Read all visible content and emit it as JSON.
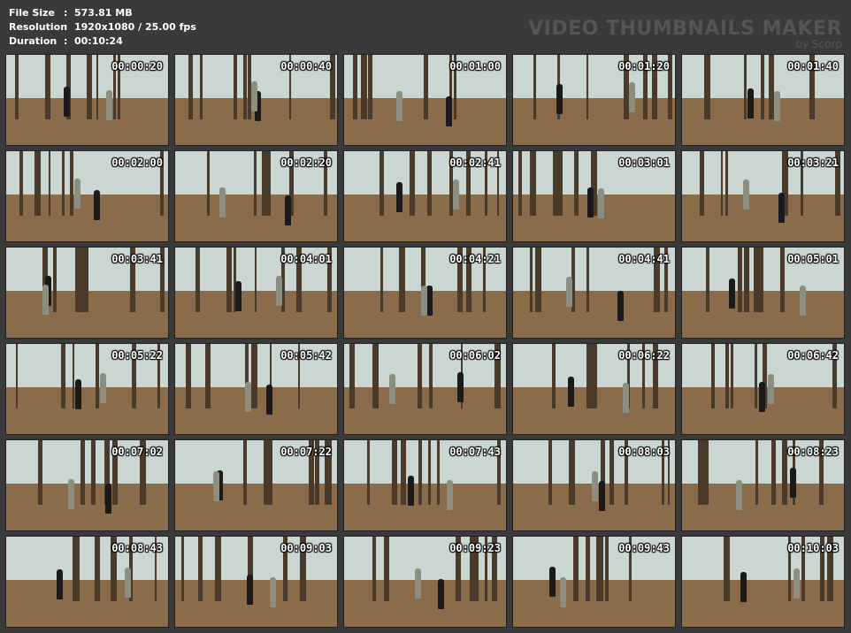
{
  "info": {
    "file_size_label": "File Size",
    "file_size_value": "573.81 MB",
    "resolution_label": "Resolution",
    "resolution_value": "1920x1080 / 25.00 fps",
    "duration_label": "Duration",
    "duration_value": "00:10:24",
    "separator": ":"
  },
  "watermark": {
    "title": "VIDEO THUMBNAILS MAKER",
    "subtitle": "by Scorp"
  },
  "colors": {
    "background": "#3a3a3a",
    "sky": "#c9d6d2",
    "ground": "#8a6c4a",
    "trunk": "#4a3a2a",
    "figure_dark": "#1a1a1a",
    "figure_camo": "#8c8f80"
  },
  "thumbnails": [
    {
      "time": "00:00:20"
    },
    {
      "time": "00:00:40"
    },
    {
      "time": "00:01:00"
    },
    {
      "time": "00:01:20"
    },
    {
      "time": "00:01:40"
    },
    {
      "time": "00:02:00"
    },
    {
      "time": "00:02:20"
    },
    {
      "time": "00:02:41"
    },
    {
      "time": "00:03:01"
    },
    {
      "time": "00:03:21"
    },
    {
      "time": "00:03:41"
    },
    {
      "time": "00:04:01"
    },
    {
      "time": "00:04:21"
    },
    {
      "time": "00:04:41"
    },
    {
      "time": "00:05:01"
    },
    {
      "time": "00:05:22"
    },
    {
      "time": "00:05:42"
    },
    {
      "time": "00:06:02"
    },
    {
      "time": "00:06:22"
    },
    {
      "time": "00:06:42"
    },
    {
      "time": "00:07:02"
    },
    {
      "time": "00:07:22"
    },
    {
      "time": "00:07:43"
    },
    {
      "time": "00:08:03"
    },
    {
      "time": "00:08:23"
    },
    {
      "time": "00:08:43"
    },
    {
      "time": "00:09:03"
    },
    {
      "time": "00:09:23"
    },
    {
      "time": "00:09:43"
    },
    {
      "time": "00:10:03"
    }
  ]
}
